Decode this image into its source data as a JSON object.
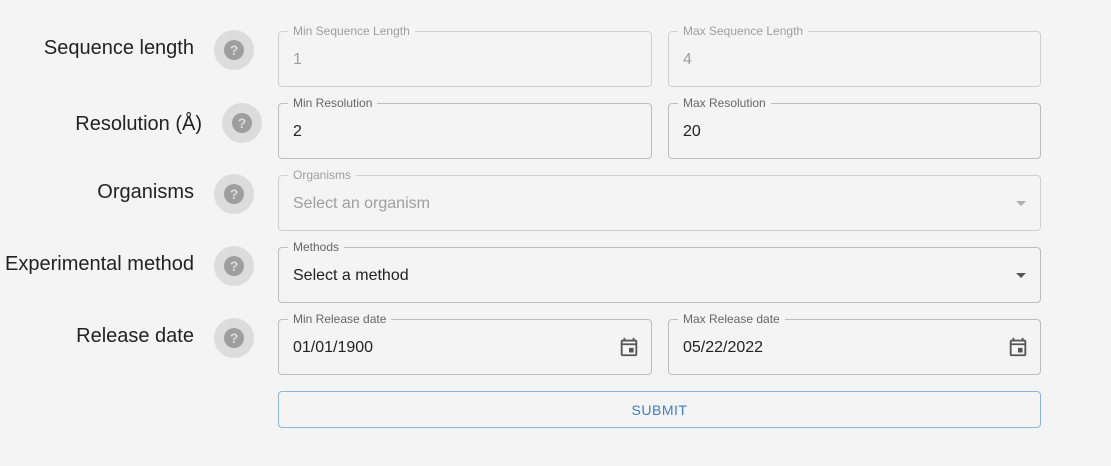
{
  "rows": {
    "sequence_length": {
      "label": "Sequence length",
      "min": {
        "legend": "Min Sequence Length",
        "value": "1"
      },
      "max": {
        "legend": "Max Sequence Length",
        "value": "4"
      }
    },
    "resolution": {
      "label": "Resolution (Å)",
      "min": {
        "legend": "Min Resolution",
        "value": "2"
      },
      "max": {
        "legend": "Max Resolution",
        "value": "20"
      }
    },
    "organisms": {
      "label": "Organisms",
      "select": {
        "legend": "Organisms",
        "placeholder": "Select an organism"
      }
    },
    "experimental_method": {
      "label": "Experimental method",
      "select": {
        "legend": "Methods",
        "value": "Select a method"
      }
    },
    "release_date": {
      "label": "Release date",
      "min": {
        "legend": "Min Release date",
        "value": "01/01/1900"
      },
      "max": {
        "legend": "Max Release date",
        "value": "05/22/2022"
      }
    }
  },
  "icons": {
    "help": "help-circle-icon",
    "dropdown": "chevron-down-icon",
    "calendar": "calendar-icon"
  },
  "submit_label": "SUBMIT",
  "colors": {
    "background": "#f4f4f4",
    "border": "#bdbdbd",
    "help_circle": "#dcdcdc",
    "accent": "#3f7dc4"
  }
}
